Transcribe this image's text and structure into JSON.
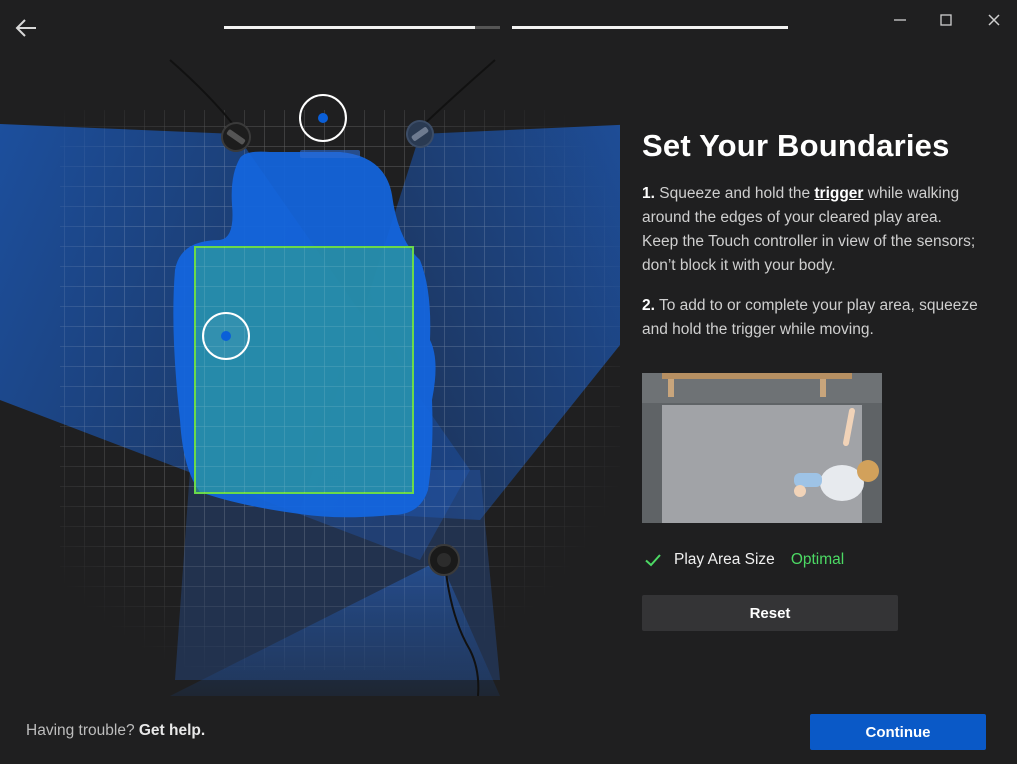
{
  "header": {
    "back_icon": "back-arrow-icon",
    "progress": [
      {
        "name": "step-1",
        "fraction": 0.91
      },
      {
        "name": "step-2",
        "fraction": 1.0
      }
    ],
    "window_controls": [
      "minimize-icon",
      "maximize-icon",
      "close-icon"
    ]
  },
  "panel": {
    "title": "Set Your Boundaries",
    "step1": {
      "number": "1.",
      "text_a": " Squeeze and hold the ",
      "link": "trigger",
      "text_b": " while walking around the edges of your cleared play area. Keep the Touch controller in view of the sensors; don’t block it with your body."
    },
    "step2": {
      "number": "2.",
      "text": " To add to or complete your play area, squeeze and hold the trigger while moving."
    },
    "status": {
      "icon": "check-icon",
      "label": "Play Area Size",
      "value": "Optimal",
      "value_color": "#4cd964"
    },
    "reset_label": "Reset"
  },
  "footer": {
    "help_text": "Having trouble? ",
    "help_link": "Get help.",
    "continue_label": "Continue",
    "accent": "#0a59c7"
  }
}
